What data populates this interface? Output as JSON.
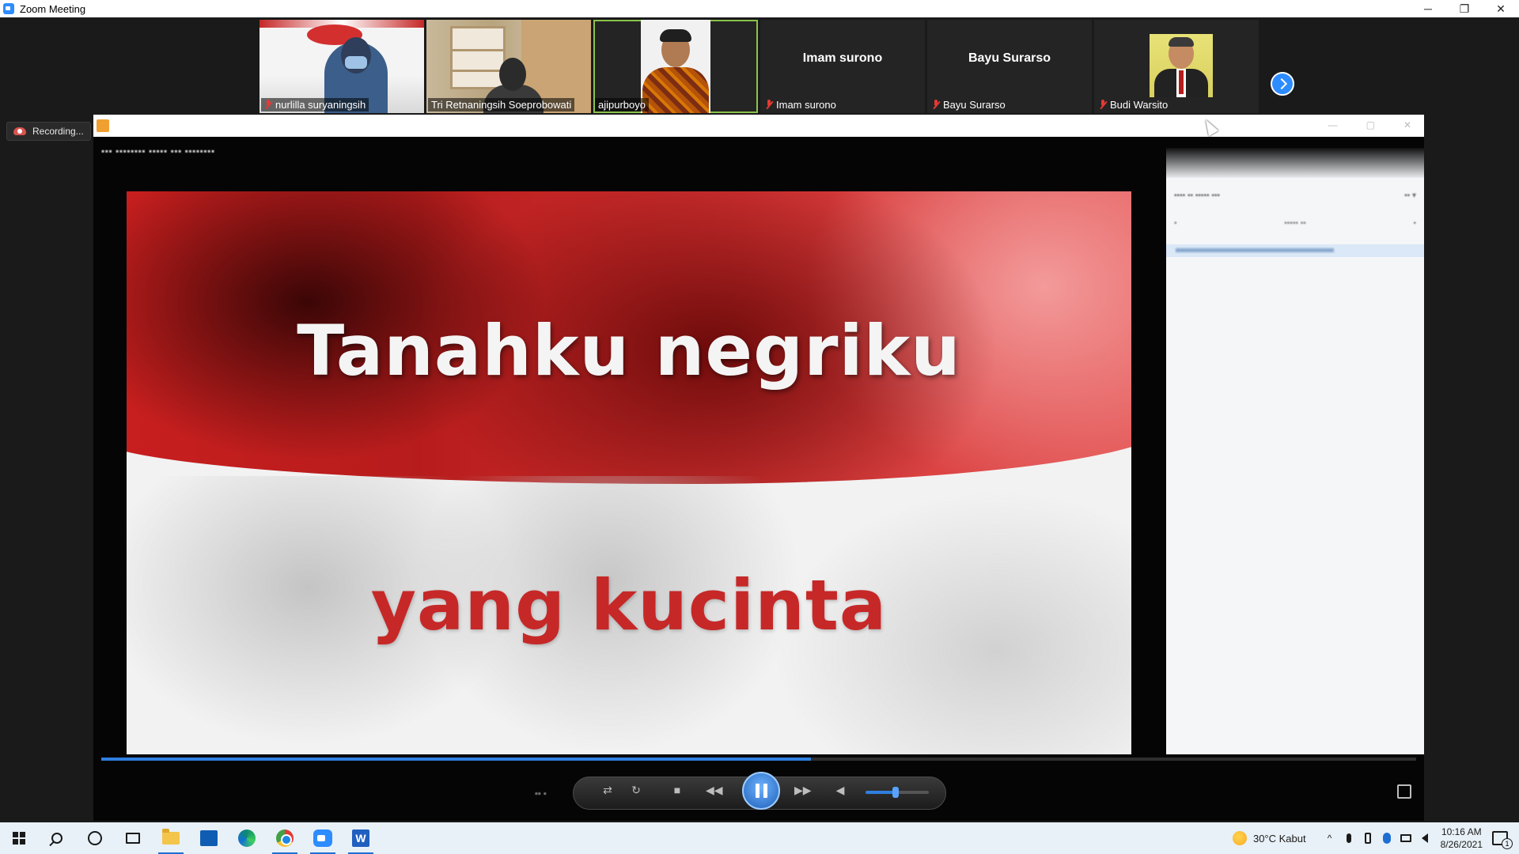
{
  "window": {
    "title": "Zoom Meeting",
    "minimize": "─",
    "restore": "❐",
    "close": "✕"
  },
  "participants": [
    {
      "name": "nurlilla suryaningsih",
      "muted": true,
      "video": true
    },
    {
      "name": "Tri Retnaningsih Soeprobowati",
      "muted": false,
      "video": true
    },
    {
      "name": "ajipurboyo",
      "muted": false,
      "video": true,
      "active_speaker": true
    },
    {
      "name": "Imam surono",
      "display_name": "Imam surono",
      "muted": true,
      "video": false
    },
    {
      "name": "Bayu Surarso",
      "display_name": "Bayu Surarso",
      "muted": true,
      "video": false
    },
    {
      "name": "Budi Warsito",
      "muted": true,
      "video": false,
      "profile_photo": true
    }
  ],
  "recording": {
    "label": "Recording..."
  },
  "shared_screen": {
    "flag_text_line1": "Tanahku negriku",
    "flag_text_line2": "yang kucinta",
    "playback_progress": 0.54,
    "volume_level": 0.45,
    "playing": true
  },
  "taskbar": {
    "icons": [
      "windows-start-icon",
      "search-icon",
      "cortana-icon",
      "task-view-icon",
      "file-explorer-icon",
      "store-icon",
      "edge-icon",
      "chrome-icon",
      "zoom-icon",
      "word-icon"
    ],
    "word_letter": "W",
    "weather": "30°C  Kabut",
    "chevron": "^",
    "time": "10:16 AM",
    "date": "8/26/2021",
    "notification_count": "1"
  }
}
